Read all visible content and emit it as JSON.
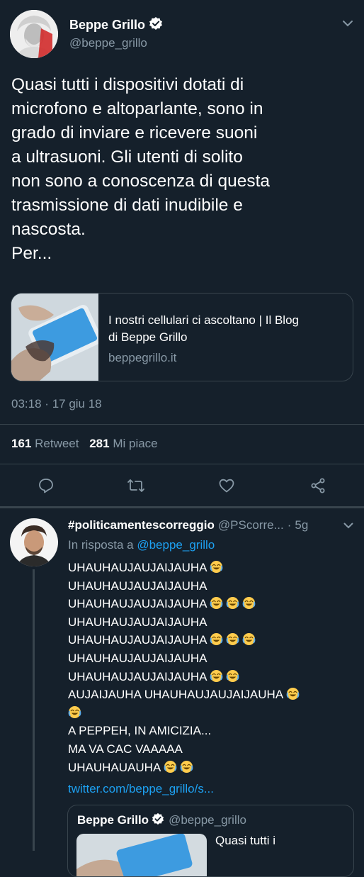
{
  "tweet": {
    "author_name": "Beppe Grillo",
    "author_handle": "@beppe_grillo",
    "text": "Quasi tutti i dispositivi dotati di\nmicrofono e altoparlante, sono in\ngrado di inviare e ricevere suoni\na ultrasuoni. Gli utenti di solito\nnon sono a conoscenza di questa\ntrasmissione di dati inudibile e\nnascosta.\nPer...",
    "card": {
      "title_line1": "I nostri cellulari ci ascoltano | Il Blog",
      "title_line2": "di Beppe Grillo",
      "domain": "beppegrillo.it"
    },
    "time": "03:18",
    "separator": "·",
    "date": "17 giu 18",
    "retweet_count": "161",
    "retweet_label": "Retweet",
    "like_count": "281",
    "like_label": "Mi piace",
    "accent_color": "#1da1f2"
  },
  "reply": {
    "author_name": "#politicamentescorreggio",
    "author_handle": "@PScorre...",
    "dot": "·",
    "age": "5g",
    "in_reply_prefix": "In risposta a",
    "in_reply_handle": "@beppe_grillo",
    "lines": [
      {
        "text": "UHAUHAUJAUJAIJAUHA",
        "emoji_count": 1
      },
      {
        "text": "UHAUHAUJAUJAIJAUHA",
        "emoji_count": 0
      },
      {
        "text": "UHAUHAUJAUJAIJAUHA",
        "emoji_count": 3
      },
      {
        "text": "UHAUHAUJAUJAIJAUHA",
        "emoji_count": 0
      },
      {
        "text": "UHAUHAUJAUJAIJAUHA",
        "emoji_count": 3
      },
      {
        "text": "UHAUHAUJAUJAIJAUHA",
        "emoji_count": 0
      },
      {
        "text": "UHAUHAUJAUJAIJAUHA",
        "emoji_count": 2
      },
      {
        "text": "AUJAIJAUHA UHAUHAUJAUJAIJAUHA",
        "emoji_count": 1
      },
      {
        "text": "",
        "emoji_count": 1
      },
      {
        "text": "A PEPPEH, IN AMICIZIA...",
        "emoji_count": 0
      },
      {
        "text": "MA VA CAC VAAAAA",
        "emoji_count": 0
      },
      {
        "text": "UHAUHAUAUHA",
        "emoji_count": 2
      }
    ],
    "link": "twitter.com/beppe_grillo/s...",
    "emoji_name": "face-with-tears-of-joy-icon",
    "quoted": {
      "author_name": "Beppe Grillo",
      "author_handle": "@beppe_grillo",
      "text_start": "Quasi tutti i"
    }
  }
}
